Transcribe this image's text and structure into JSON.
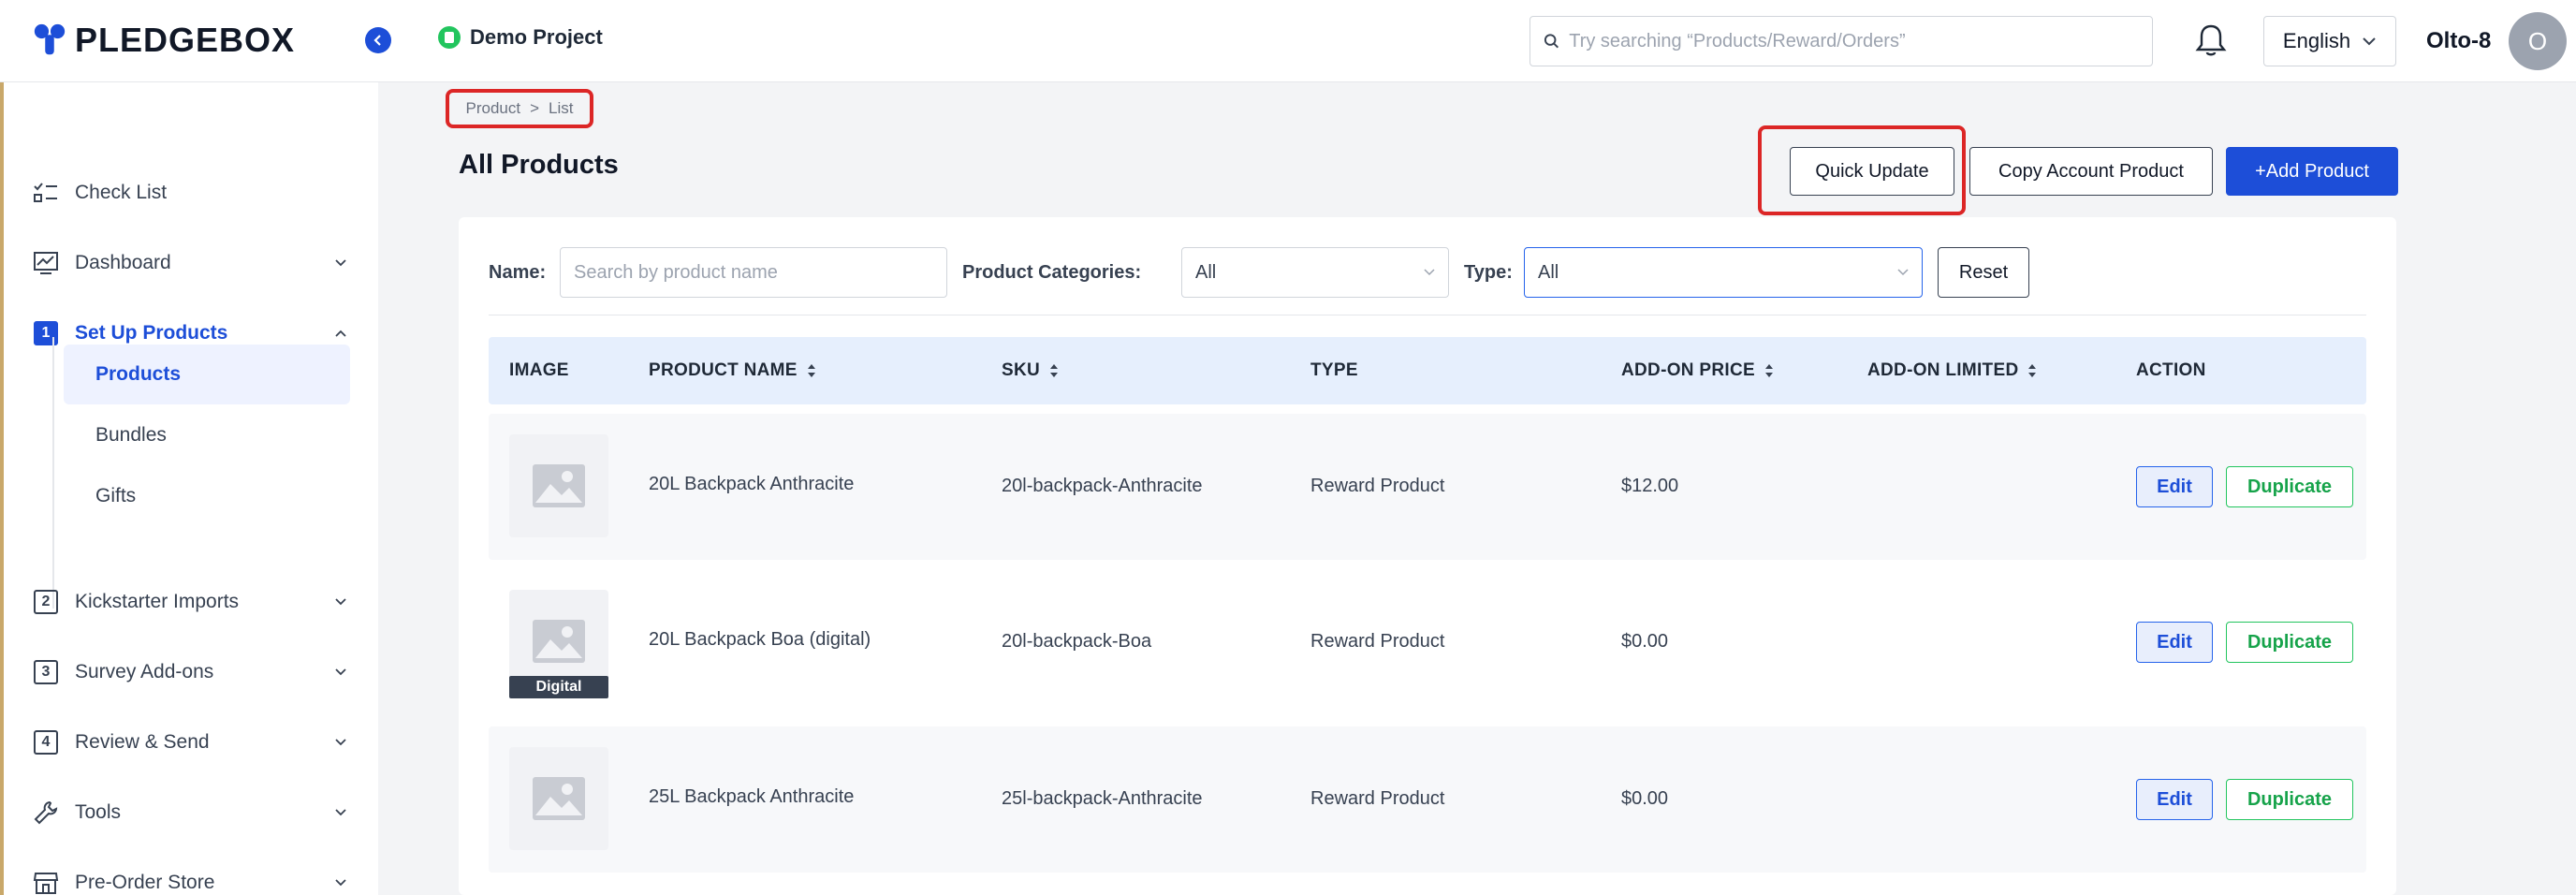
{
  "header": {
    "logo_text": "PLEDGEBOX",
    "project_name": "Demo Project",
    "search_placeholder": "Try searching “Products/Reward/Orders”",
    "language": "English",
    "user_name": "Olto-8",
    "avatar_initial": "O"
  },
  "sidebar": {
    "items": [
      {
        "label": "Check List",
        "icon": "checklist-icon"
      },
      {
        "label": "Dashboard",
        "icon": "dashboard-icon"
      },
      {
        "label": "Set Up Products",
        "number": "1"
      },
      {
        "label": "Kickstarter Imports",
        "number": "2"
      },
      {
        "label": "Survey Add-ons",
        "number": "3"
      },
      {
        "label": "Review & Send",
        "number": "4"
      },
      {
        "label": "Tools",
        "icon": "wrench-icon"
      },
      {
        "label": "Pre-Order Store",
        "icon": "store-icon"
      }
    ],
    "sub_items": [
      {
        "label": "Products"
      },
      {
        "label": "Bundles"
      },
      {
        "label": "Gifts"
      }
    ]
  },
  "breadcrumb": {
    "first": "Product",
    "separator": ">",
    "second": "List"
  },
  "page": {
    "title": "All Products"
  },
  "toolbar": {
    "quick_update": "Quick Update",
    "copy_account_product": "Copy Account Product",
    "add_product": "+Add Product"
  },
  "filters": {
    "name_label": "Name",
    "name_placeholder": "Search by product name",
    "categories_label": "Product Categories",
    "categories_value": "All",
    "type_label": "Type",
    "type_value": "All",
    "reset": "Reset"
  },
  "table": {
    "columns": [
      "IMAGE",
      "PRODUCT NAME",
      "SKU",
      "TYPE",
      "ADD-ON PRICE",
      "ADD-ON LIMITED",
      "ACTION"
    ],
    "rows": [
      {
        "name": "20L Backpack Anthracite",
        "sku": "20l-backpack-Anthracite",
        "type": "Reward Product",
        "price": "$12.00",
        "limited": "",
        "badge": ""
      },
      {
        "name": "20L Backpack Boa  (digital)",
        "sku": "20l-backpack-Boa",
        "type": "Reward Product",
        "price": "$0.00",
        "limited": "",
        "badge": "Digital"
      },
      {
        "name": "25L Backpack Anthracite",
        "sku": "25l-backpack-Anthracite",
        "type": "Reward Product",
        "price": "$0.00",
        "limited": "",
        "badge": ""
      }
    ],
    "edit_label": "Edit",
    "duplicate_label": "Duplicate"
  },
  "colors": {
    "accent": "#1d4ed8",
    "highlight": "#dc2626",
    "success": "#16a34a",
    "header_row": "#e6effd"
  }
}
